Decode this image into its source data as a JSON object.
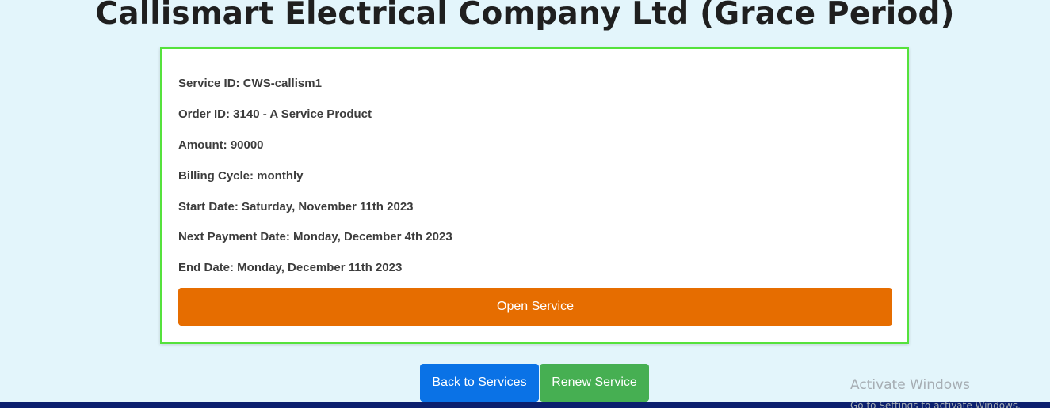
{
  "page": {
    "title": "Callismart Electrical Company Ltd (Grace Period)"
  },
  "service": {
    "service_id": "Service ID: CWS-callism1",
    "order_id": "Order ID: 3140 - A Service Product",
    "amount": "Amount: 90000",
    "billing_cycle": "Billing Cycle: monthly",
    "start_date": "Start Date: Saturday, November 11th 2023",
    "next_payment_date": "Next Payment Date: Monday, December 4th 2023",
    "end_date": "End Date: Monday, December 11th 2023",
    "open_label": "Open Service"
  },
  "actions": {
    "back_label": "Back to Services",
    "renew_label": "Renew Service"
  },
  "watermark": {
    "title": "Activate Windows",
    "subtitle": "Go to Settings to activate Windows."
  },
  "colors": {
    "background": "#e3f5fb",
    "card_border": "#55e23c",
    "open_button": "#e66d00",
    "back_button": "#0a72e6",
    "renew_button": "#46af52",
    "taskbar": "#0b1f6e"
  }
}
